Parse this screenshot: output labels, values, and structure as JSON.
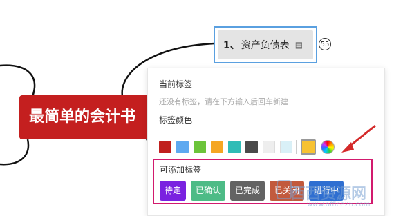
{
  "mindmap": {
    "root_label": "最简单的会计书",
    "child": {
      "number": "1、",
      "label": "资产负债表",
      "note_icon": "note-icon"
    },
    "count_badge": "55",
    "colors": {
      "root": "#c41f1f",
      "child_border": "#5aa0e0"
    }
  },
  "popup": {
    "current_tags_title": "当前标签",
    "no_tags_hint": "还没有标签，请在下方输入后回车新建",
    "tag_color_title": "标签颜色",
    "swatches": [
      {
        "name": "swatch-red",
        "color": "#c0201e"
      },
      {
        "name": "swatch-blue",
        "color": "#5ea9f0"
      },
      {
        "name": "swatch-green",
        "color": "#6cc43a"
      },
      {
        "name": "swatch-orange",
        "color": "#f5a623"
      },
      {
        "name": "swatch-teal",
        "color": "#2fbcb6"
      },
      {
        "name": "swatch-dark-gray",
        "color": "#4a4a4a"
      },
      {
        "name": "swatch-light-gray",
        "color": "#eeeeee"
      },
      {
        "name": "swatch-light-cyan",
        "color": "#d9f0f7"
      },
      {
        "name": "swatch-yellow",
        "color": "#f7c232"
      }
    ],
    "addable_tags_title": "可添加标签",
    "tags": [
      {
        "label": "待定",
        "color": "#7a22e0"
      },
      {
        "label": "已确认",
        "color": "#4dbb86"
      },
      {
        "label": "已完成",
        "color": "#636363"
      },
      {
        "label": "已关闭",
        "color": "#c25a3d"
      },
      {
        "label": "进行中",
        "color": "#2f6fd1"
      }
    ]
  },
  "watermark": {
    "title": "西西资源网",
    "url": "www.office26.com"
  }
}
